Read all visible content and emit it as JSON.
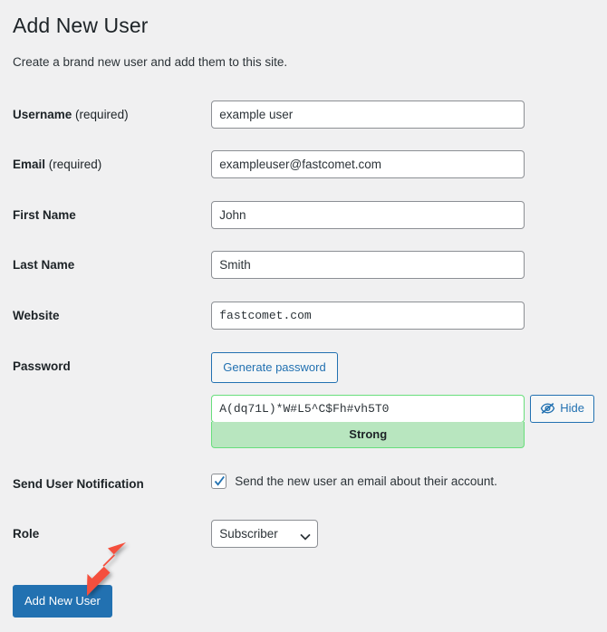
{
  "header": {
    "title": "Add New User",
    "description": "Create a brand new user and add them to this site."
  },
  "form": {
    "username": {
      "label": "Username",
      "required_note": " (required)",
      "value": "example user"
    },
    "email": {
      "label": "Email",
      "required_note": " (required)",
      "value": "exampleuser@fastcomet.com"
    },
    "first_name": {
      "label": "First Name",
      "value": "John"
    },
    "last_name": {
      "label": "Last Name",
      "value": "Smith"
    },
    "website": {
      "label": "Website",
      "value": "fastcomet.com"
    },
    "password": {
      "label": "Password",
      "generate_button": "Generate password",
      "value": "A(dq71L)*W#L5^C$Fh#vh5T0",
      "strength": "Strong",
      "hide_button": "Hide",
      "hide_icon": "eye-slash-icon",
      "strength_bg_color": "#b8e6bf",
      "strength_border_color": "#68de7c"
    },
    "notification": {
      "label": "Send User Notification",
      "checkbox_checked": true,
      "checkbox_text": "Send the new user an email about their account."
    },
    "role": {
      "label": "Role",
      "selected": "Subscriber",
      "caret_icon": "chevron-down-icon"
    }
  },
  "submit": {
    "label": "Add New User",
    "color": "#2271b1"
  },
  "annotation": {
    "arrow_icon": "arrow-pointer-down-left",
    "color": "#f4503c"
  }
}
